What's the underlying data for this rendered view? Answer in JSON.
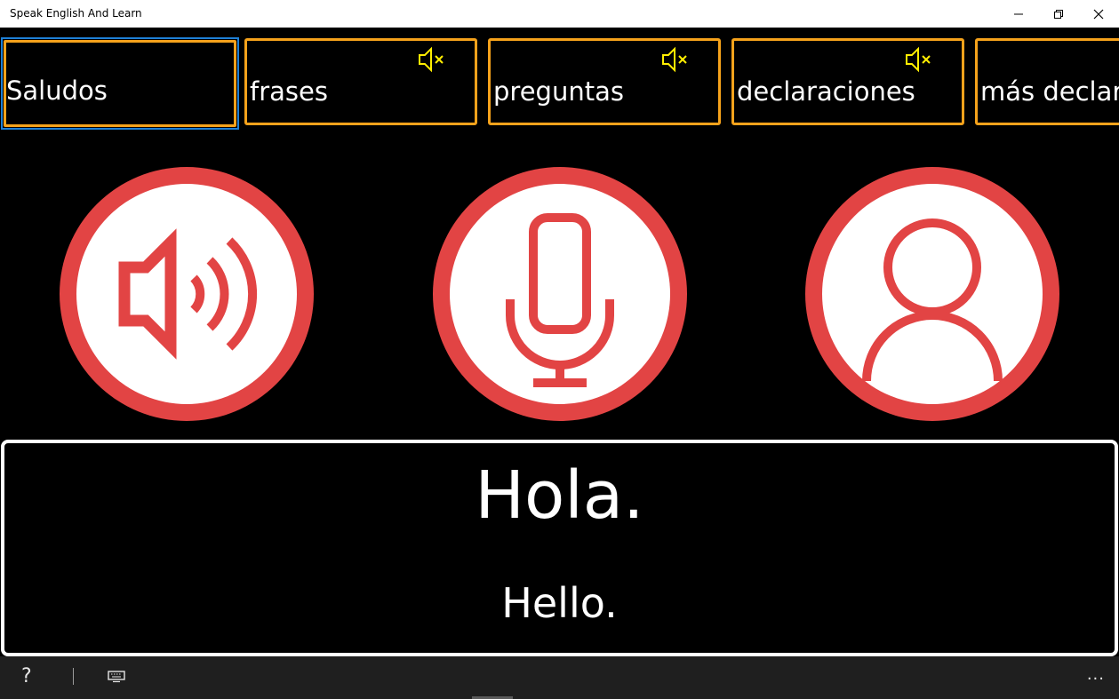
{
  "window": {
    "title": "Speak English And Learn",
    "controls": [
      "minimize",
      "restore",
      "close"
    ]
  },
  "tabs": [
    {
      "label": "Saludos",
      "selected": true,
      "muted": false
    },
    {
      "label": "frases",
      "selected": false,
      "muted": true
    },
    {
      "label": "preguntas",
      "selected": false,
      "muted": true
    },
    {
      "label": "declaraciones",
      "selected": false,
      "muted": true
    },
    {
      "label": "más declaraciones",
      "selected": false,
      "muted": false
    }
  ],
  "actions": [
    {
      "icon": "speaker-icon",
      "purpose": "play"
    },
    {
      "icon": "microphone-icon",
      "purpose": "record"
    },
    {
      "icon": "user-icon",
      "purpose": "profile"
    }
  ],
  "phrase": {
    "text": "Hola.",
    "translation": "Hello."
  },
  "appbar": {
    "help_label": "?",
    "keyboard_icon": "keyboard-icon",
    "more_label": "..."
  },
  "colors": {
    "accent_red": "#e24444",
    "tab_border": "#f5a21b",
    "mute_icon": "#ffee00",
    "selection_border": "#1e80d6"
  }
}
